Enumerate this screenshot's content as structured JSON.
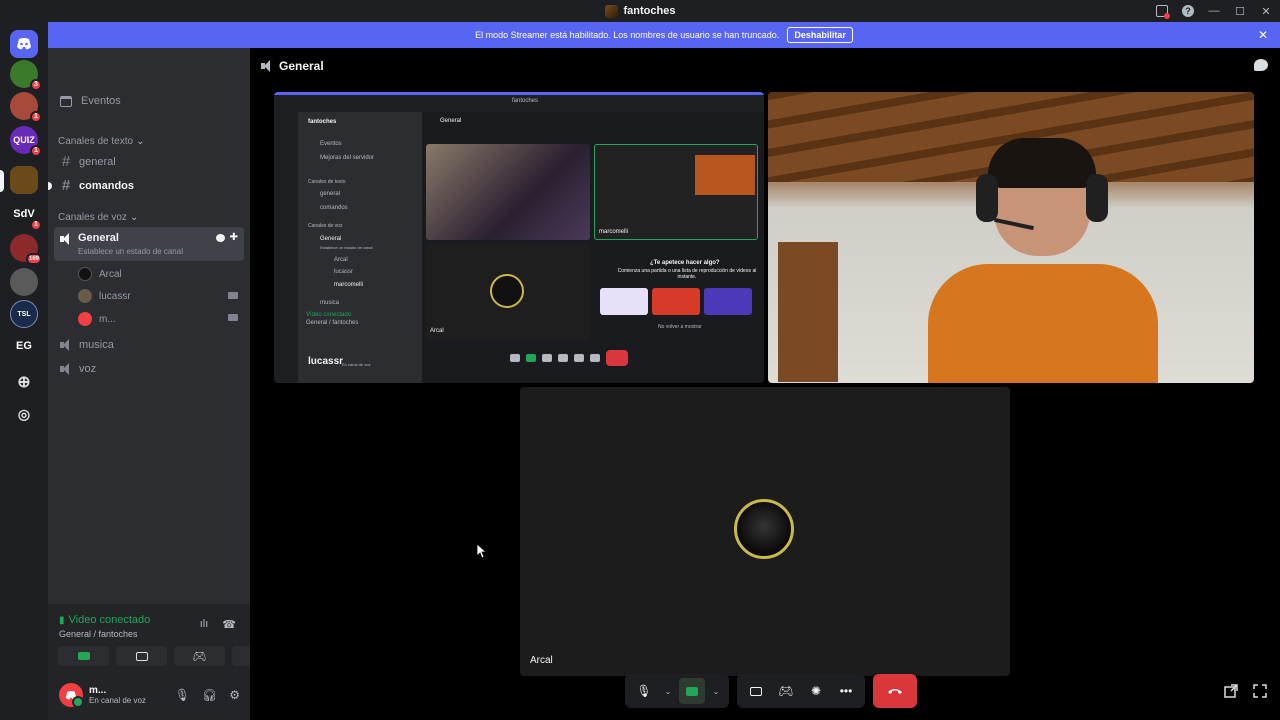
{
  "window": {
    "title": "fantoches"
  },
  "banner": {
    "message": "El modo Streamer está habilitado. Los nombres de usuario se han truncado.",
    "button": "Deshabilitar"
  },
  "guilds": [
    {
      "name": "guild-1",
      "badge": "3",
      "color": "#3a7a2a"
    },
    {
      "name": "guild-2",
      "badge": "1",
      "color": "#a84a3a"
    },
    {
      "name": "guild-quiz",
      "label": "QUIZ",
      "badge": "1",
      "color": "#6a2ab8"
    },
    {
      "name": "guild-fantoches",
      "badge": "",
      "color": "#6b4a1a"
    },
    {
      "name": "guild-sdv",
      "label": "SdV",
      "badge": "1",
      "color": "#1e1f22"
    },
    {
      "name": "guild-6",
      "badge": "169",
      "color": "#8a2a2a"
    },
    {
      "name": "guild-7",
      "badge": "",
      "color": "#5a5a5a"
    },
    {
      "name": "guild-tsl",
      "label": "TSL",
      "badge": "",
      "color": "#1a2a4a"
    },
    {
      "name": "guild-eg",
      "label": "EG",
      "badge": "",
      "color": "#1e1f22"
    }
  ],
  "server": {
    "name": "fantoches",
    "events_label": "Eventos",
    "text_category": "Canales de texto",
    "text_channels": [
      "general",
      "comandos"
    ],
    "voice_category": "Canales de voz",
    "voice_channels": {
      "active": {
        "name": "General",
        "status_placeholder": "Establece un estado de canal"
      },
      "users": [
        "Arcal",
        "lucassr",
        "m..."
      ],
      "others": [
        "musica",
        "voz"
      ]
    }
  },
  "panel": {
    "status": "Video conectado",
    "location": "General / fantoches",
    "user": {
      "name": "m...",
      "status": "En canal de voz"
    }
  },
  "main": {
    "channel_title": "General",
    "tiles": {
      "arcal_label": "Arcal"
    },
    "mini": {
      "server": "fantoches",
      "events": "Eventos",
      "boost": "Mejoras del servidor",
      "text_cat": "Canales de texto",
      "general": "general",
      "comandos": "comandos",
      "voice_cat": "Canales de voz",
      "voice_general": "General",
      "voice_status": "Establece un estado de canal",
      "u1": "Arcal",
      "u2": "lucassr",
      "u3": "marcomelli",
      "musica": "musica",
      "channel": "General",
      "tile_user": "marcomelli",
      "tile_arcal": "Arcal",
      "prompt_title": "¿Te apetece hacer algo?",
      "prompt_body": "Comienza una partida o una lista de reproducción de vídeos al instante.",
      "prompt_check": "No volver a mostrar",
      "vc_status": "Vídeo conectado",
      "vc_location": "General / fantoches",
      "user_name": "lucassr",
      "user_status": "En canal de voz"
    }
  },
  "colors": {
    "accent": "#5865f2",
    "online": "#23a55a",
    "danger": "#da373c"
  }
}
